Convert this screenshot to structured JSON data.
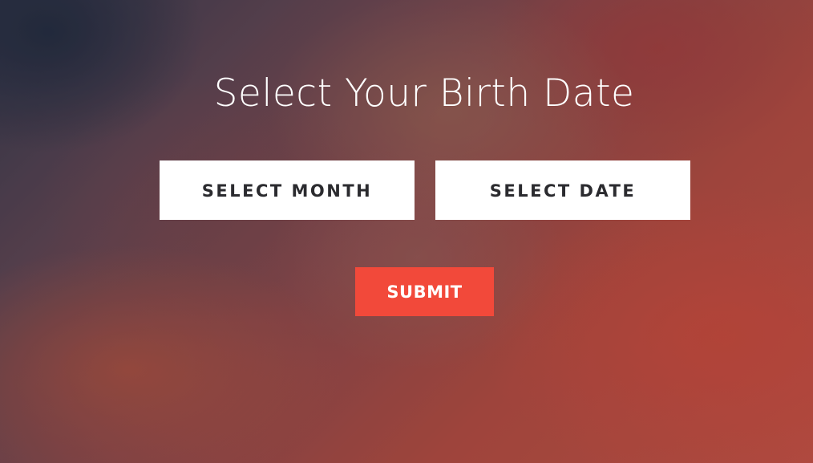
{
  "page": {
    "title": "Select Your Birth Date"
  },
  "form": {
    "month_select_label": "SELECT MONTH",
    "date_select_label": "SELECT DATE",
    "submit_label": "SUBMIT"
  },
  "colors": {
    "submit_button": "#f2493a",
    "select_box": "#ffffff",
    "select_text": "#2b2b2f",
    "title_text": "#ffffff"
  }
}
